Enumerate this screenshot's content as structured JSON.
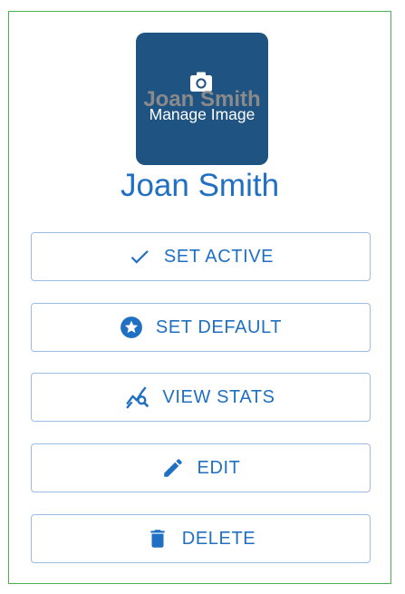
{
  "profile": {
    "name": "Joan Smith",
    "avatar_placeholder": "Joan Smith",
    "manage_image_label": "Manage Image"
  },
  "actions": [
    {
      "label": "SET ACTIVE",
      "icon": "check-icon"
    },
    {
      "label": "SET DEFAULT",
      "icon": "star-circle-icon"
    },
    {
      "label": "VIEW STATS",
      "icon": "stats-search-icon"
    },
    {
      "label": "EDIT",
      "icon": "pencil-icon"
    },
    {
      "label": "DELETE",
      "icon": "trash-icon"
    }
  ],
  "colors": {
    "accent": "#1f6fc2",
    "avatar_background": "#1f5382",
    "card_border": "#4caf50",
    "button_border": "#9bbde3"
  }
}
